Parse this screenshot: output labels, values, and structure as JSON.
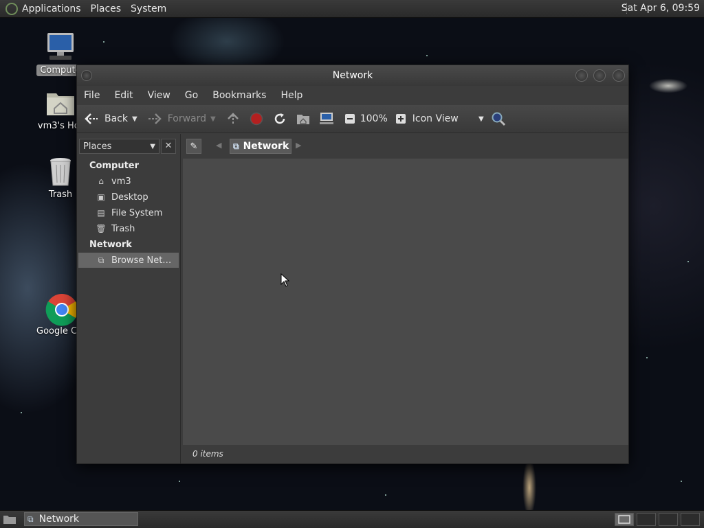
{
  "top_panel": {
    "menus": [
      "Applications",
      "Places",
      "System"
    ],
    "clock": "Sat Apr  6, 09:59"
  },
  "desktop_icons": [
    {
      "label": "Compute",
      "icon": "computer-icon"
    },
    {
      "label": "vm3's Hor",
      "icon": "home-folder-icon"
    },
    {
      "label": "Trash",
      "icon": "trash-icon"
    },
    {
      "label": "Google Chr",
      "icon": "chrome-icon"
    }
  ],
  "window": {
    "title": "Network",
    "menubar": [
      "File",
      "Edit",
      "View",
      "Go",
      "Bookmarks",
      "Help"
    ],
    "toolbar": {
      "back": "Back",
      "forward": "Forward",
      "zoom": "100%",
      "view_mode": "Icon View"
    },
    "sidebar": {
      "selector": "Places",
      "sections": [
        {
          "title": "Computer",
          "items": [
            "vm3",
            "Desktop",
            "File System",
            "Trash"
          ]
        },
        {
          "title": "Network",
          "items": [
            "Browse Net…"
          ]
        }
      ]
    },
    "path": {
      "current": "Network"
    },
    "status": "0 items"
  },
  "bottom_panel": {
    "task": "Network"
  }
}
